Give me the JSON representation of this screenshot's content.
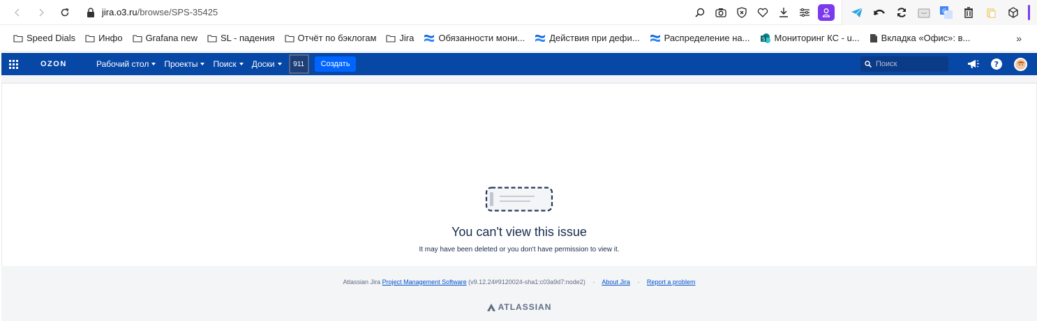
{
  "browser": {
    "url_host": "jira.o3.ru",
    "url_path": "/browse/SPS-35425"
  },
  "bookmarks": [
    {
      "label": "Speed Dials",
      "icon": "folder-icon"
    },
    {
      "label": "Инфо",
      "icon": "folder-icon"
    },
    {
      "label": "Grafana new",
      "icon": "folder-icon"
    },
    {
      "label": "SL - падения",
      "icon": "folder-icon"
    },
    {
      "label": "Отчёт по бэклогам",
      "icon": "folder-icon"
    },
    {
      "label": "Jira",
      "icon": "folder-icon"
    },
    {
      "label": "Обязанности мони...",
      "icon": "confluence-icon"
    },
    {
      "label": "Действия при дефи...",
      "icon": "confluence-icon"
    },
    {
      "label": "Распределение на...",
      "icon": "confluence-icon"
    },
    {
      "label": "Мониторинг КС - u...",
      "icon": "sharepoint-icon"
    },
    {
      "label": "Вкладка «Офис»: в...",
      "icon": "document-icon"
    }
  ],
  "bookmarks_more": "»",
  "jira": {
    "logo": "OZON",
    "menu": [
      "Рабочий стол",
      "Проекты",
      "Поиск",
      "Доски"
    ],
    "count": "911",
    "create_label": "Создать",
    "search_placeholder": "Поиск"
  },
  "error": {
    "title": "You can't view this issue",
    "subtitle": "It may have been deleted or you don't have permission to view it."
  },
  "footer": {
    "prefix": "Atlassian Jira",
    "pms_link": "Project Management Software",
    "version": "(v9.12.24#9120024-sha1:c03a9d7:node2)",
    "sep": "·",
    "about": "About Jira",
    "report": "Report a problem",
    "brand": "ATLASSIAN"
  },
  "colors": {
    "jira_header": "#0747a6",
    "create_button": "#0065ff",
    "profile": "#7c3aed"
  }
}
